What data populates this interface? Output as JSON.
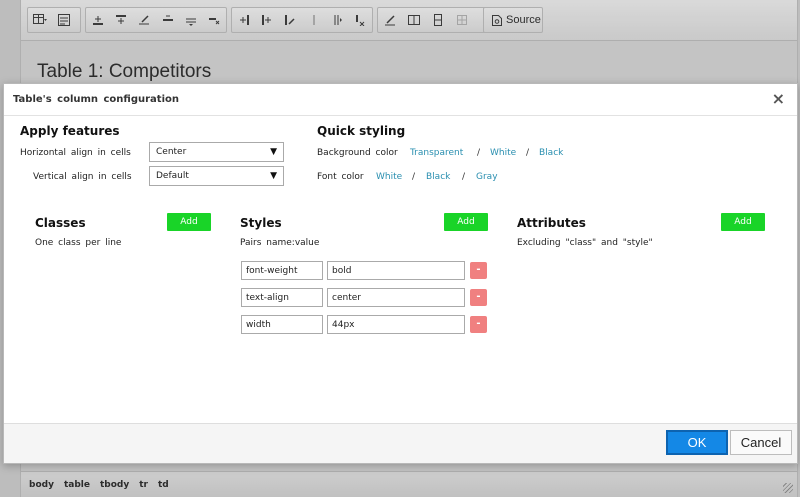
{
  "editor": {
    "content_title": "Table 1: Competitors",
    "source_label": "Source",
    "breadcrumbs": [
      "body",
      "table",
      "tbody",
      "tr",
      "td"
    ]
  },
  "dialog": {
    "title": "Table's column configuration",
    "close_glyph": "×",
    "apply_features": {
      "title": "Apply features",
      "horizontal_label": "Horizontal align in cells",
      "horizontal_value": "Center",
      "vertical_label": "Vertical align in cells",
      "vertical_value": "Default"
    },
    "quick_styling": {
      "title": "Quick styling",
      "background_label": "Background color",
      "background_options": [
        "Transparent",
        "White",
        "Black"
      ],
      "font_label": "Font color",
      "font_options": [
        "White",
        "Black",
        "Gray"
      ],
      "separator": "/"
    },
    "classes": {
      "title": "Classes",
      "hint": "One class per line",
      "add_label": "Add"
    },
    "styles": {
      "title": "Styles",
      "hint": "Pairs name:value",
      "add_label": "Add",
      "remove_glyph": "-",
      "rows": [
        {
          "name": "font-weight",
          "value": "bold"
        },
        {
          "name": "text-align",
          "value": "center"
        },
        {
          "name": "width",
          "value": "44px"
        }
      ]
    },
    "attributes": {
      "title": "Attributes",
      "hint": "Excluding \"class\" and \"style\"",
      "add_label": "Add"
    },
    "ok_label": "OK",
    "cancel_label": "Cancel"
  },
  "colors": {
    "link": "#2a8fb0",
    "add_button": "#19d428",
    "remove_button": "#f08080",
    "ok_button": "#1488e6"
  }
}
